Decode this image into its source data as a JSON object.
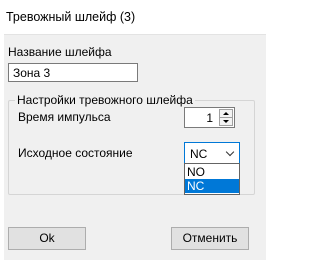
{
  "window": {
    "title": "Тревожный шлейф (3)"
  },
  "loop_name": {
    "label": "Название шлейфа",
    "value": "Зона 3"
  },
  "settings": {
    "legend": "Настройки тревожного шлейфа",
    "pulse_time_label": "Время импульса",
    "pulse_time_value": "1",
    "initial_state_label": "Исходное состояние",
    "initial_state_value": "NC",
    "initial_state_options": [
      "NO",
      "NC"
    ]
  },
  "buttons": {
    "ok": "Ok",
    "cancel": "Отменить"
  },
  "colors": {
    "accent": "#0078d7",
    "panel": "#f0f0f0"
  }
}
